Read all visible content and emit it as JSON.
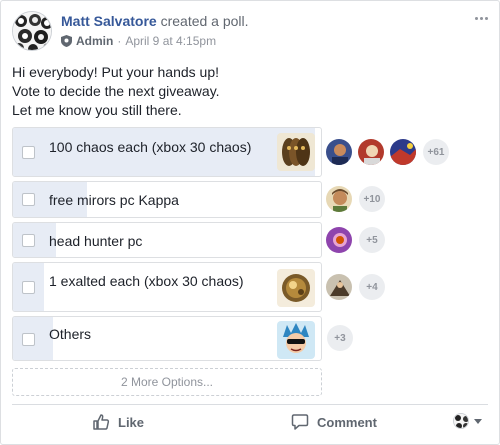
{
  "post": {
    "author": "Matt Salvatore",
    "action_text": "created a poll.",
    "role": "Admin",
    "separator": "·",
    "timestamp": "April 9 at 4:15pm",
    "body_lines": [
      "Hi everybody! Put your hands up!",
      "Vote to decide the next giveaway.",
      "Let me know you still there."
    ]
  },
  "poll": {
    "options": [
      {
        "label": "100 chaos each (xbox 30 chaos)",
        "more_voters": "+61",
        "vote_share": 0.98
      },
      {
        "label": "free mirors pc Kappa",
        "more_voters": "+10",
        "vote_share": 0.24
      },
      {
        "label": "head hunter pc",
        "more_voters": "+5",
        "vote_share": 0.14
      },
      {
        "label": "1 exalted each (xbox 30 chaos)",
        "more_voters": "+4",
        "vote_share": 0.1
      },
      {
        "label": "Others",
        "more_voters": "+3",
        "vote_share": 0.13
      }
    ],
    "more_options_label": "2 More Options..."
  },
  "actions": {
    "like_label": "Like",
    "comment_label": "Comment"
  },
  "colors": {
    "author_link": "#365899",
    "bar_fill": "#e7ecf5",
    "muted_text": "#90949c"
  }
}
